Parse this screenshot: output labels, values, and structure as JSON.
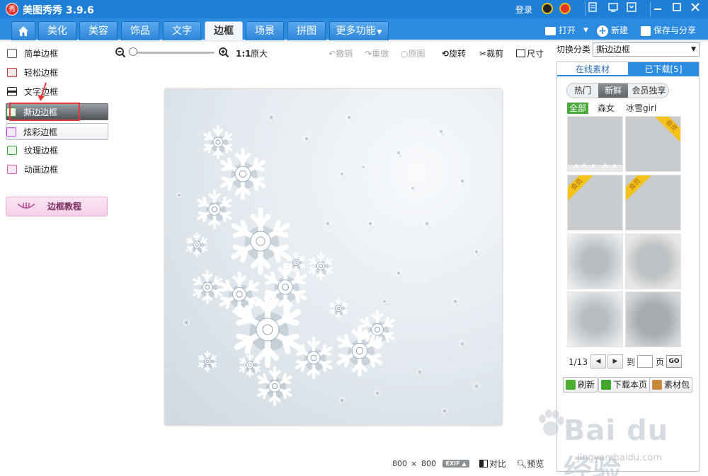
{
  "app": {
    "logo_char": "秀",
    "title": "美图秀秀 3.9.6"
  },
  "titlebar": {
    "login": "登录"
  },
  "nav": {
    "tabs": [
      "美化",
      "美容",
      "饰品",
      "文字",
      "边框",
      "场景",
      "拼图",
      "更多功能"
    ],
    "active_tab": "边框",
    "open": "打开",
    "new": "新建",
    "save_share": "保存与分享"
  },
  "sidebar": {
    "items": [
      "简单边框",
      "轻松边框",
      "文字边框",
      "撕边边框",
      "炫彩边框",
      "纹理边框",
      "动画边框"
    ],
    "selected": "撕边边框",
    "tutorial": "边框教程"
  },
  "toolbar": {
    "ratio": "1:1",
    "original_size": "原大",
    "undo": "撤销",
    "redo": "重做",
    "original": "原图",
    "rotate": "旋转",
    "crop": "裁剪",
    "resize": "尺寸"
  },
  "status": {
    "width": "800",
    "times": "×",
    "height": "800",
    "exif": "EXIF",
    "compare": "对比",
    "preview": "预览"
  },
  "right_panel": {
    "switch_label": "切换分类",
    "category": "撕边边框",
    "tab_online": "在线素材",
    "tab_downloaded": "已下载[5]",
    "pills": [
      "热门",
      "新鲜",
      "会员独享"
    ],
    "active_pill": "新鲜",
    "filters": [
      "全部",
      "森女",
      "冰雪girl"
    ],
    "vip_label": "会员",
    "page_indicator": "1/13",
    "goto": "到",
    "page_unit": "页",
    "go": "GO",
    "refresh": "刷新",
    "download_page": "下载本页",
    "material_pack": "素材包"
  },
  "watermark": {
    "text": "Bai du 经验",
    "url": "jingyan.baidu.com"
  }
}
